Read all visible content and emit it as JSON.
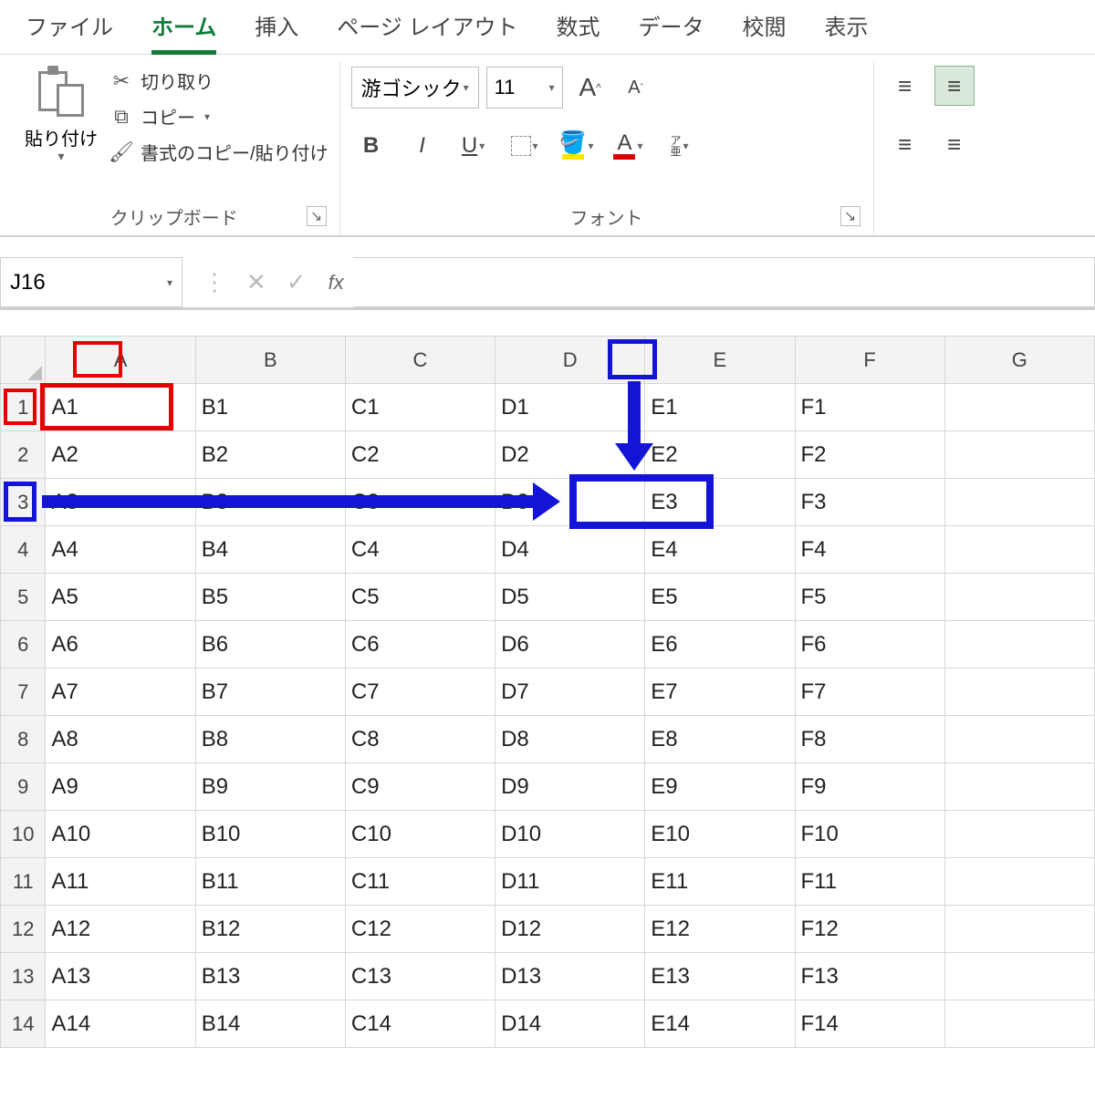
{
  "tabs": {
    "file": "ファイル",
    "home": "ホーム",
    "insert": "挿入",
    "page_layout": "ページ レイアウト",
    "formulas": "数式",
    "data": "データ",
    "review": "校閲",
    "view": "表示"
  },
  "clipboard": {
    "paste": "貼り付け",
    "cut": "切り取り",
    "copy": "コピー",
    "format_painter": "書式のコピー/貼り付け",
    "group_label": "クリップボード"
  },
  "font": {
    "name": "游ゴシック",
    "size": "11",
    "grow_label": "A^",
    "shrink_label": "A^",
    "bold": "B",
    "italic": "I",
    "underline": "U",
    "phonetic": "ア\n亜",
    "group_label": "フォント"
  },
  "name_box": "J16",
  "fx_label": "fx",
  "columns": [
    "A",
    "B",
    "C",
    "D",
    "E",
    "F",
    "G"
  ],
  "rows": [
    [
      "A1",
      "B1",
      "C1",
      "D1",
      "E1",
      "F1",
      ""
    ],
    [
      "A2",
      "B2",
      "C2",
      "D2",
      "E2",
      "F2",
      ""
    ],
    [
      "A3",
      "B3",
      "C3",
      "D3",
      "E3",
      "F3",
      ""
    ],
    [
      "A4",
      "B4",
      "C4",
      "D4",
      "E4",
      "F4",
      ""
    ],
    [
      "A5",
      "B5",
      "C5",
      "D5",
      "E5",
      "F5",
      ""
    ],
    [
      "A6",
      "B6",
      "C6",
      "D6",
      "E6",
      "F6",
      ""
    ],
    [
      "A7",
      "B7",
      "C7",
      "D7",
      "E7",
      "F7",
      ""
    ],
    [
      "A8",
      "B8",
      "C8",
      "D8",
      "E8",
      "F8",
      ""
    ],
    [
      "A9",
      "B9",
      "C9",
      "D9",
      "E9",
      "F9",
      ""
    ],
    [
      "A10",
      "B10",
      "C10",
      "D10",
      "E10",
      "F10",
      ""
    ],
    [
      "A11",
      "B11",
      "C11",
      "D11",
      "E11",
      "F11",
      ""
    ],
    [
      "A12",
      "B12",
      "C12",
      "D12",
      "E12",
      "F12",
      ""
    ],
    [
      "A13",
      "B13",
      "C13",
      "D13",
      "E13",
      "F13",
      ""
    ],
    [
      "A14",
      "B14",
      "C14",
      "D14",
      "E14",
      "F14",
      ""
    ]
  ],
  "annotations": {
    "red_col_header": "A",
    "red_row_header": "1",
    "red_cell": "A1",
    "blue_col_header": "E",
    "blue_row_header": "3",
    "blue_cell": "E3"
  }
}
